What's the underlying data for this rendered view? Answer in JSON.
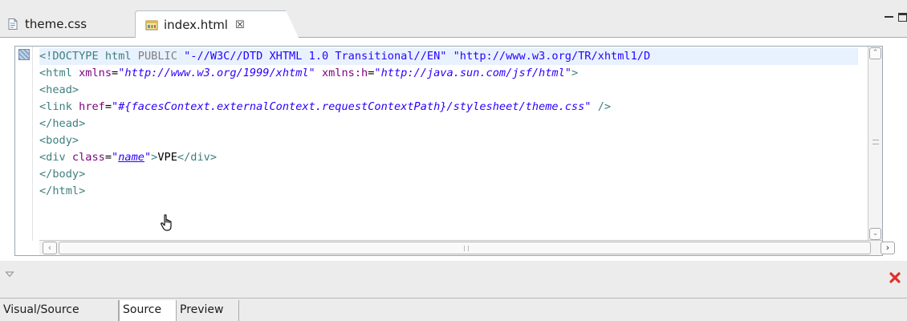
{
  "tabs": [
    {
      "label": "theme.css",
      "icon": "css-file-icon"
    },
    {
      "label": "index.html",
      "icon": "html-file-icon",
      "active": true,
      "close": "☒"
    }
  ],
  "code_lines": [
    [
      {
        "c": "tag",
        "t": "<!"
      },
      {
        "c": "dtk",
        "t": "DOCTYPE "
      },
      {
        "c": "kw",
        "t": "html "
      },
      {
        "c": "pub",
        "t": "PUBLIC "
      },
      {
        "c": "dval",
        "t": "\"-//W3C//DTD XHTML 1.0 Transitional//EN\" \"http://www.w3.org/TR/xhtml1/D"
      }
    ],
    [
      {
        "c": "tag",
        "t": "<html "
      },
      {
        "c": "attr",
        "t": "xmlns"
      },
      {
        "c": "txt",
        "t": "="
      },
      {
        "c": "val",
        "t": "\"http://www.w3.org/1999/xhtml\""
      },
      {
        "c": "txt",
        "t": " "
      },
      {
        "c": "attr",
        "t": "xmlns:h"
      },
      {
        "c": "txt",
        "t": "="
      },
      {
        "c": "val",
        "t": "\"http://java.sun.com/jsf/html\""
      },
      {
        "c": "tag",
        "t": ">"
      }
    ],
    [
      {
        "c": "tag",
        "t": "<head>"
      }
    ],
    [
      {
        "c": "tag",
        "t": "<link "
      },
      {
        "c": "attr",
        "t": "href"
      },
      {
        "c": "txt",
        "t": "="
      },
      {
        "c": "val",
        "t": "\"#{facesContext.externalContext.requestContextPath}/stylesheet/theme.css\""
      },
      {
        "c": "txt",
        "t": " "
      },
      {
        "c": "tag",
        "t": "/>"
      }
    ],
    [
      {
        "c": "tag",
        "t": "</head>"
      }
    ],
    [
      {
        "c": "tag",
        "t": "<body>"
      }
    ],
    [
      {
        "c": "tag",
        "t": "<div "
      },
      {
        "c": "attr",
        "t": "class"
      },
      {
        "c": "txt",
        "t": "="
      },
      {
        "c": "val",
        "t": "\""
      },
      {
        "c": "link",
        "t": "name"
      },
      {
        "c": "val",
        "t": "\""
      },
      {
        "c": "tag",
        "t": ">"
      },
      {
        "c": "txt",
        "t": "VPE"
      },
      {
        "c": "tag",
        "t": "</div>"
      }
    ],
    [
      {
        "c": "tag",
        "t": "</body>"
      }
    ],
    [
      {
        "c": "tag",
        "t": "</html>"
      }
    ]
  ],
  "bottom_tabs": [
    {
      "label": "Visual/Source"
    },
    {
      "label": "Source",
      "active": true
    },
    {
      "label": "Preview"
    }
  ],
  "colors": {
    "tag": "#3f7f7f",
    "attribute": "#7f007f",
    "value": "#2a00ff",
    "current_line": "#e8f2fe",
    "error": "#e0302a"
  }
}
